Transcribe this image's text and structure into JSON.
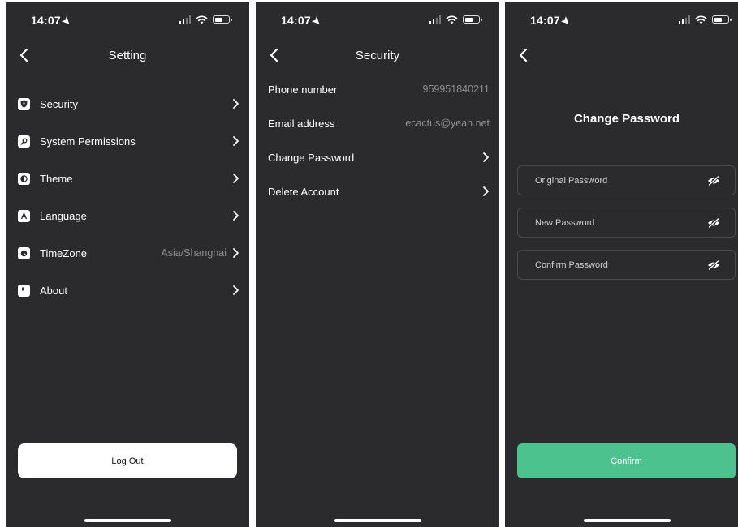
{
  "status_bar": {
    "time": "14:07",
    "location_icon": "location-arrow-icon"
  },
  "setting_screen": {
    "title": "Setting",
    "items": [
      {
        "label": "Security",
        "icon": "shield-icon",
        "value": ""
      },
      {
        "label": "System Permissions",
        "icon": "key-icon",
        "value": ""
      },
      {
        "label": "Theme",
        "icon": "theme-icon",
        "value": ""
      },
      {
        "label": "Language",
        "icon": "language-icon",
        "value": ""
      },
      {
        "label": "TimeZone",
        "icon": "clock-icon",
        "value": "Asia/Shanghai"
      },
      {
        "label": "About",
        "icon": "info-icon",
        "value": ""
      }
    ],
    "logout_label": "Log Out"
  },
  "security_screen": {
    "title": "Security",
    "items": [
      {
        "label": "Phone number",
        "value": "959951840211"
      },
      {
        "label": "Email address",
        "value": "ecactus@yeah.net"
      },
      {
        "label": "Change Password",
        "value": ""
      },
      {
        "label": "Delete Account",
        "value": ""
      }
    ]
  },
  "change_password_screen": {
    "title": "Change Password",
    "fields": [
      {
        "placeholder": "Original Password",
        "value": ""
      },
      {
        "placeholder": "New Password",
        "value": ""
      },
      {
        "placeholder": "Confirm Password",
        "value": ""
      }
    ],
    "confirm_label": "Confirm"
  },
  "colors": {
    "background": "#2b2a2c",
    "accent": "#4cc28f",
    "muted_text": "#8f8f91"
  }
}
